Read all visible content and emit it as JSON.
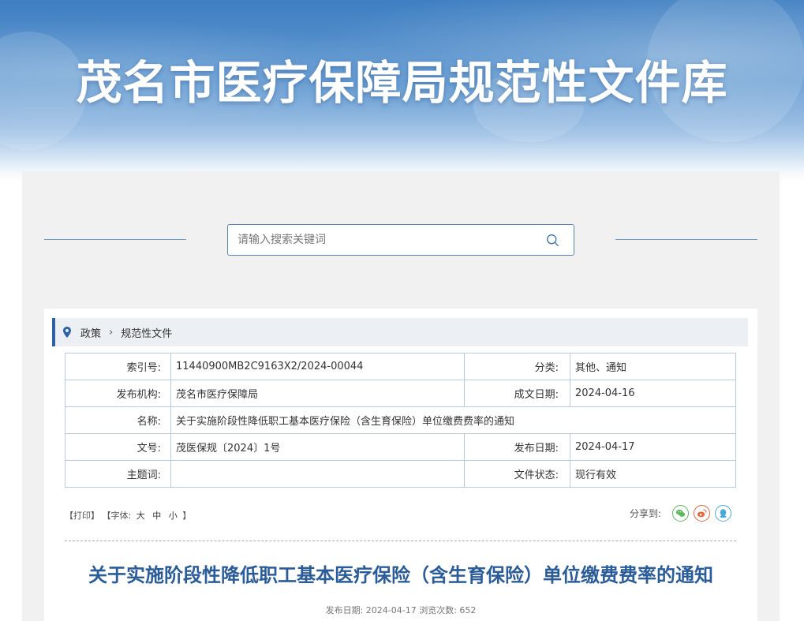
{
  "banner": {
    "title": "茂名市医疗保障局规范性文件库"
  },
  "search": {
    "placeholder": "请输入搜索关键词"
  },
  "breadcrumb": {
    "items": [
      "政策",
      "规范性文件"
    ]
  },
  "meta": {
    "index_label": "索引号:",
    "index_value": "11440900MB2C9163X2/2024-00044",
    "category_label": "分类:",
    "category_value": "其他、通知",
    "publisher_label": "发布机构:",
    "publisher_value": "茂名市医疗保障局",
    "created_label": "成文日期:",
    "created_value": "2024-04-16",
    "name_label": "名称:",
    "name_value": "关于实施阶段性降低职工基本医疗保险（含生育保险）单位缴费费率的通知",
    "docno_label": "文号:",
    "docno_value": "茂医保规〔2024〕1号",
    "published_label": "发布日期:",
    "published_value": "2024-04-17",
    "subject_label": "主题词:",
    "subject_value": "",
    "status_label": "文件状态:",
    "status_value": "现行有效"
  },
  "tools": {
    "print": "【打印】",
    "font_prefix": "【字体:",
    "font_large": "大",
    "font_medium": "中",
    "font_small": "小",
    "font_suffix": "】",
    "share_label": "分享到:"
  },
  "icons": {
    "wechat": "wechat-icon",
    "weibo": "weibo-icon",
    "qq": "qq-icon"
  },
  "colors": {
    "accent": "#2d63a6",
    "title": "#2a5c9a",
    "wechat": "#5cb85c",
    "weibo": "#e8643a",
    "qq": "#4aa8dc"
  },
  "article": {
    "title": "关于实施阶段性降低职工基本医疗保险（含生育保险）单位缴费费率的通知",
    "meta": "发布日期: 2024-04-17   浏览次数: 652"
  }
}
